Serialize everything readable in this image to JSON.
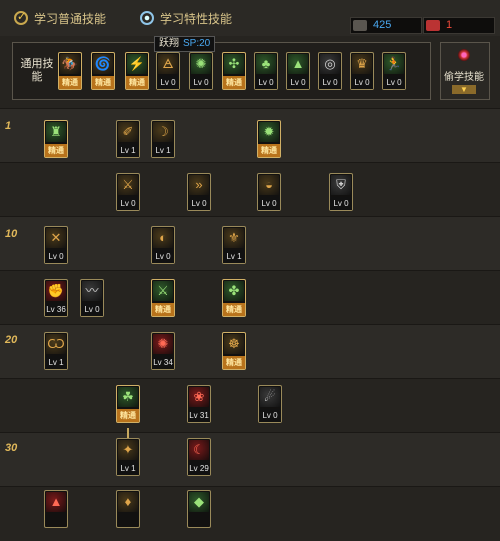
{
  "header": {
    "tab_common": "学习普通技能",
    "tab_special": "学习特性技能",
    "sp_value": "425",
    "tp_value": "1"
  },
  "general": {
    "label": "通用技能",
    "tooltip_name": "跃翔",
    "tooltip_cost": "SP:20",
    "skills": [
      {
        "icon": "rider-icon",
        "glyph": "🏇",
        "tone": "gold",
        "caption": "精通"
      },
      {
        "icon": "flame-wheel-icon",
        "glyph": "🌀",
        "tone": "gold",
        "caption": "精通"
      },
      {
        "icon": "green-strike-icon",
        "glyph": "⚡",
        "tone": "green",
        "caption": "精通"
      },
      {
        "icon": "wing-icon",
        "glyph": "🜁",
        "tone": "gold",
        "caption": "Lv 0"
      },
      {
        "icon": "green-orb-icon",
        "glyph": "✺",
        "tone": "green",
        "caption": "Lv 0"
      },
      {
        "icon": "green-crosshair-icon",
        "glyph": "✣",
        "tone": "green",
        "caption": "精通"
      },
      {
        "icon": "plant-icon",
        "glyph": "♣",
        "tone": "green",
        "caption": "Lv 0"
      },
      {
        "icon": "mountain-icon",
        "glyph": "▲",
        "tone": "green",
        "caption": "Lv 0"
      },
      {
        "icon": "ring-icon",
        "glyph": "◎",
        "tone": "grey",
        "caption": "Lv 0"
      },
      {
        "icon": "golden-statue-icon",
        "glyph": "♛",
        "tone": "gold",
        "caption": "Lv 0"
      },
      {
        "icon": "green-runner-icon",
        "glyph": "🏃",
        "tone": "green",
        "caption": "Lv 0"
      }
    ],
    "learn_label": "偷学技能"
  },
  "level_marks": [
    "1",
    "10",
    "20",
    "30"
  ],
  "tree": [
    {
      "icon": "green-tower-icon",
      "glyph": "♜",
      "tone": "green",
      "caption": "精通"
    },
    {
      "icon": "slash-icon",
      "glyph": "✐",
      "tone": "gold",
      "caption": "Lv 1"
    },
    {
      "icon": "sweep-icon",
      "glyph": "☽",
      "tone": "gold",
      "caption": "Lv 1"
    },
    {
      "icon": "green-burst-icon",
      "glyph": "✹",
      "tone": "green",
      "caption": "精通"
    },
    {
      "icon": "dash-slash-icon",
      "glyph": "⚔",
      "tone": "gold",
      "caption": "Lv 0"
    },
    {
      "icon": "arrows-icon",
      "glyph": "»",
      "tone": "gold",
      "caption": "Lv 0"
    },
    {
      "icon": "crescent-icon",
      "glyph": "◒",
      "tone": "gold",
      "caption": "Lv 0"
    },
    {
      "icon": "shield-icon",
      "glyph": "⛨",
      "tone": "grey",
      "caption": "Lv 0"
    },
    {
      "icon": "cross-strike-icon",
      "glyph": "✕",
      "tone": "gold",
      "caption": "Lv 0"
    },
    {
      "icon": "whirl-icon",
      "glyph": "◐",
      "tone": "gold",
      "caption": "Lv 0"
    },
    {
      "icon": "blade-storm-icon",
      "glyph": "⚜",
      "tone": "gold",
      "caption": "Lv 1"
    },
    {
      "icon": "red-fist-icon",
      "glyph": "✊",
      "tone": "red",
      "caption": "Lv 36"
    },
    {
      "icon": "wind-slash-icon",
      "glyph": "〰",
      "tone": "grey",
      "caption": "Lv 0"
    },
    {
      "icon": "green-blade-icon",
      "glyph": "⚔",
      "tone": "green",
      "caption": "精通"
    },
    {
      "icon": "green-rune-icon",
      "glyph": "✤",
      "tone": "green",
      "caption": "精通"
    },
    {
      "icon": "claw-icon",
      "glyph": "Ѡ",
      "tone": "gold",
      "caption": "Lv 1"
    },
    {
      "icon": "red-vortex-icon",
      "glyph": "✺",
      "tone": "red",
      "caption": "Lv 34"
    },
    {
      "icon": "golden-buddha-icon",
      "glyph": "☸",
      "tone": "gold",
      "caption": "精通"
    },
    {
      "icon": "green-spirit-icon",
      "glyph": "☘",
      "tone": "green",
      "caption": "精通"
    },
    {
      "icon": "red-rose-icon",
      "glyph": "❀",
      "tone": "red",
      "caption": "Lv 31"
    },
    {
      "icon": "meteor-icon",
      "glyph": "☄",
      "tone": "grey",
      "caption": "Lv 0"
    },
    {
      "icon": "gold-spark-icon",
      "glyph": "✦",
      "tone": "gold",
      "caption": "Lv 1"
    },
    {
      "icon": "red-crescent-icon",
      "glyph": "☾",
      "tone": "red",
      "caption": "Lv 29"
    },
    {
      "icon": "red-flame-icon",
      "glyph": "▲",
      "tone": "red",
      "caption": ""
    },
    {
      "icon": "gold-lantern-icon",
      "glyph": "♦",
      "tone": "gold",
      "caption": ""
    },
    {
      "icon": "green-gem-icon",
      "glyph": "◆",
      "tone": "green",
      "caption": ""
    }
  ]
}
